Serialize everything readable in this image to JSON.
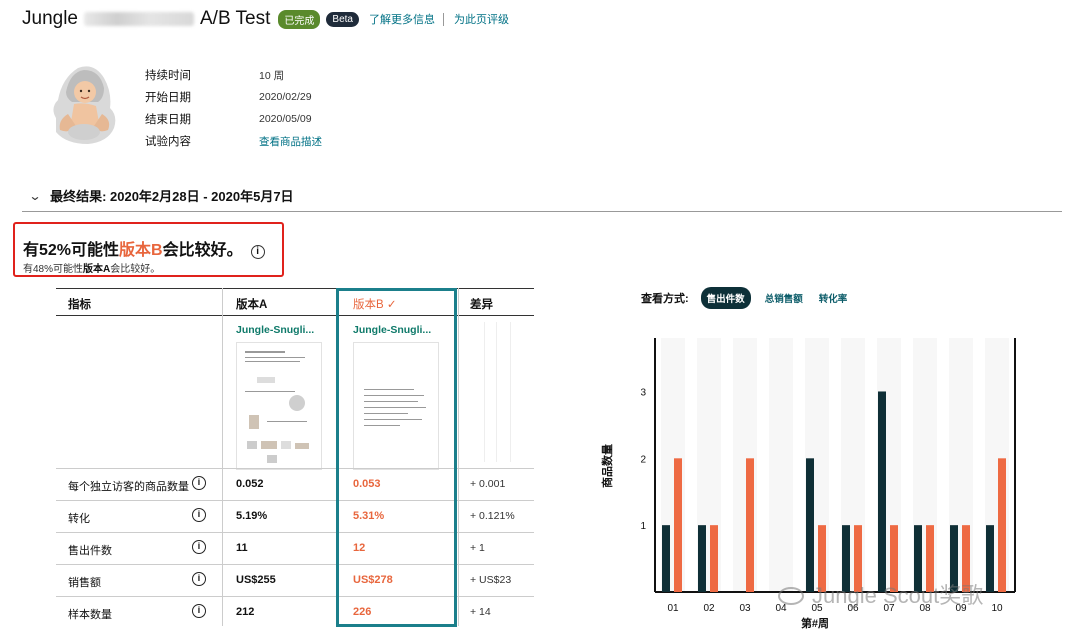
{
  "header": {
    "title_prefix": "Jungle",
    "title_suffix": "A/B Test",
    "status_badge": "已完成",
    "beta_badge": "Beta",
    "learn_more_link": "了解更多信息",
    "rate_link": "为此页评级"
  },
  "meta": {
    "duration_label": "持续时间",
    "duration_value": "10 周",
    "start_label": "开始日期",
    "start_value": "2020/02/29",
    "end_label": "结束日期",
    "end_value": "2020/05/09",
    "content_label": "试验内容",
    "content_link": "查看商品描述"
  },
  "final_result": {
    "label": "最终结果: 2020年2月28日 - 2020年5月7日"
  },
  "callout": {
    "head_pre": "有52%可能性",
    "head_version": "版本B",
    "head_post": "会比较好。",
    "info_icon": "i",
    "sub_pre": "有48%可能性",
    "sub_version": "版本A",
    "sub_post": "会比较好。"
  },
  "table": {
    "col_metric": "指标",
    "col_a": "版本A",
    "col_b": "版本B",
    "col_b_check": "✓",
    "col_diff": "差异",
    "product_a_title": "Jungle-Snugli...",
    "product_b_title": "Jungle-Snugli...",
    "info_glyph": "i",
    "rows": [
      {
        "metric": "每个独立访客的商品数量",
        "a": "0.052",
        "b": "0.053",
        "diff": "+ 0.001"
      },
      {
        "metric": "转化",
        "a": "5.19%",
        "b": "5.31%",
        "diff": "+ 0.121%"
      },
      {
        "metric": "售出件数",
        "a": "11",
        "b": "12",
        "diff": "+ 1"
      },
      {
        "metric": "销售额",
        "a": "US$255",
        "b": "US$278",
        "diff": "+ US$23"
      },
      {
        "metric": "样本数量",
        "a": "212",
        "b": "226",
        "diff": "+ 14"
      }
    ]
  },
  "view": {
    "label": "查看方式:",
    "options": [
      "售出件数",
      "总销售额",
      "转化率"
    ],
    "selected": "售出件数"
  },
  "colors": {
    "version_a": "#0f2f36",
    "version_b": "#ee6a43",
    "teal_highlight": "#1b7f8b",
    "callout_border": "#e0221c"
  },
  "chart_data": {
    "type": "bar",
    "categories": [
      "01",
      "02",
      "03",
      "04",
      "05",
      "06",
      "07",
      "08",
      "09",
      "10"
    ],
    "series": [
      {
        "values": [
          1,
          1,
          0,
          0,
          2,
          1,
          3,
          1,
          1,
          1
        ]
      },
      {
        "values": [
          2,
          1,
          2,
          0,
          1,
          1,
          1,
          1,
          1,
          2
        ]
      }
    ],
    "xlabel": "第#周",
    "ylabel": "商品数量",
    "yticks": [
      "1",
      "2",
      "3"
    ],
    "ylim": [
      0,
      3.8
    ],
    "grid": false
  },
  "watermark": "Jungle Scout奖歌"
}
